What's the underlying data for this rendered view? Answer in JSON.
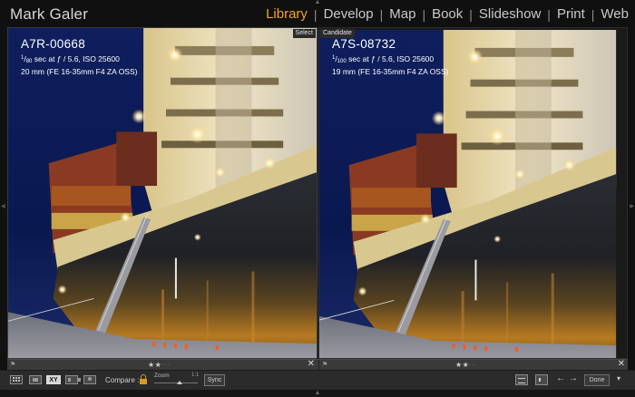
{
  "identity_plate": "Mark Galer",
  "modules": [
    "Library",
    "Develop",
    "Map",
    "Book",
    "Slideshow",
    "Print",
    "Web"
  ],
  "active_module": "Library",
  "select_panel": {
    "tag": "Select",
    "filename": "A7R-00668",
    "shutter_num": "1",
    "shutter_den": "80",
    "exposure_rest": " sec at ƒ / 5.6, ISO 25600",
    "lens": "20 mm (FE 16-35mm F4 ZA OSS)",
    "rating": 2
  },
  "candidate_panel": {
    "tag": "Candidate",
    "filename": "A7S-08732",
    "shutter_num": "1",
    "shutter_den": "100",
    "exposure_rest": " sec at ƒ / 5.6, ISO 25600",
    "lens": "19 mm (FE 16-35mm F4 ZA OSS)",
    "rating": 2
  },
  "toolbar": {
    "compare_label": "Compare :",
    "zoom_label": "Zoom",
    "zoom_ratio": "1:1",
    "zoom_level": 0.58,
    "sync_label": "Sync",
    "done_label": "Done",
    "xy_label": "XY"
  },
  "icons": {
    "grid": "grid-view-icon",
    "loupe": "loupe-view-icon",
    "compare": "compare-view-icon",
    "survey": "survey-view-icon",
    "people": "people-view-icon",
    "lock": "lock-icon",
    "swap": "swap-icon",
    "make_select": "make-select-icon",
    "prev": "arrow-left-icon",
    "next": "arrow-right-icon",
    "close": "close-icon",
    "flag": "flag-icon"
  },
  "colors": {
    "active_module": "#f5a623",
    "lock": "#d79b23"
  }
}
